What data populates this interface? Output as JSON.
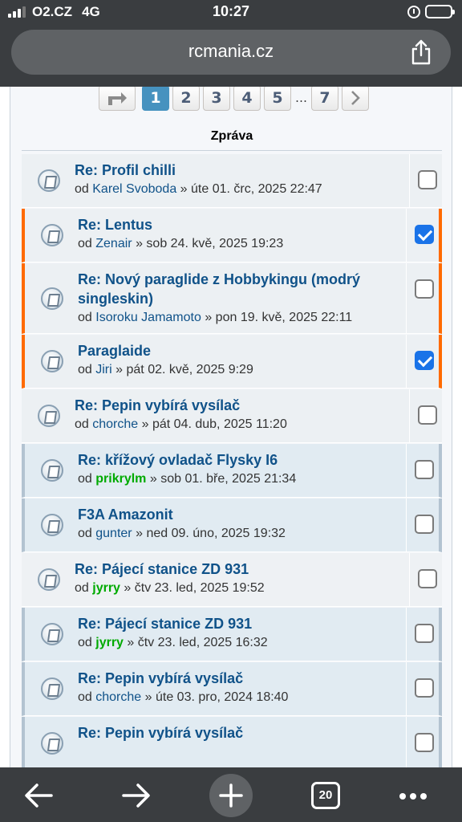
{
  "status": {
    "carrier": "O2.CZ",
    "network": "4G",
    "time": "10:27",
    "battery_level": 1.0
  },
  "browser": {
    "url": "rcmania.cz",
    "tabs_count": "20",
    "icons": [
      "back-arrow-icon",
      "forward-arrow-icon",
      "new-tab-icon",
      "tabs-icon",
      "more-icon",
      "share-icon"
    ]
  },
  "pagination": {
    "pages": [
      "1",
      "2",
      "3",
      "4",
      "5"
    ],
    "ellipsis": "…",
    "last": "7",
    "active": "1"
  },
  "column_header": "Zpráva",
  "posts": [
    {
      "title": "Re: Profil chilli",
      "by": "od",
      "author": "Karel Svoboda",
      "author_color": "blue",
      "sep": "»",
      "date": "úte 01. črc, 2025 22:47",
      "checked": false,
      "style": "bg1"
    },
    {
      "title": "Re: Lentus",
      "by": "od",
      "author": "Zenair",
      "author_color": "blue",
      "sep": "»",
      "date": "sob 24. kvě, 2025 19:23",
      "checked": true,
      "style": "bg1 marked"
    },
    {
      "title": "Re: Nový paraglide z Hobbykingu (modrý singleskin)",
      "by": "od",
      "author": "Isoroku Jamamoto",
      "author_color": "blue",
      "sep": "»",
      "date": "pon 19. kvě, 2025 22:11",
      "checked": false,
      "style": "bg1 marked"
    },
    {
      "title": "Paraglaide",
      "by": "od",
      "author": "Jiri",
      "author_color": "blue",
      "sep": "»",
      "date": "pát 02. kvě, 2025 9:29",
      "checked": true,
      "style": "bg1 marked"
    },
    {
      "title": "Re: Pepin vybírá vysílač",
      "by": "od",
      "author": "chorche",
      "author_color": "blue",
      "sep": "»",
      "date": "pát 04. dub, 2025 11:20",
      "checked": false,
      "style": "bg1"
    },
    {
      "title": "Re: křížový ovladač Flysky I6",
      "by": "od",
      "author": "prikrylm",
      "author_color": "green",
      "sep": "»",
      "date": "sob 01. bře, 2025 21:34",
      "checked": false,
      "style": "bg2 pm"
    },
    {
      "title": "F3A Amazonit",
      "by": "od",
      "author": "gunter",
      "author_color": "blue",
      "sep": "»",
      "date": "ned 09. úno, 2025 19:32",
      "checked": false,
      "style": "bg2 pm"
    },
    {
      "title": "Re: Pájecí stanice ZD 931",
      "by": "od",
      "author": "jyrry",
      "author_color": "green",
      "sep": "»",
      "date": "čtv 23. led, 2025 19:52",
      "checked": false,
      "style": "bg3"
    },
    {
      "title": "Re: Pájecí stanice ZD 931",
      "by": "od",
      "author": "jyrry",
      "author_color": "green",
      "sep": "»",
      "date": "čtv 23. led, 2025 16:32",
      "checked": false,
      "style": "bg2 pm"
    },
    {
      "title": "Re: Pepin vybírá vysílač",
      "by": "od",
      "author": "chorche",
      "author_color": "blue",
      "sep": "»",
      "date": "úte 03. pro, 2024 18:40",
      "checked": false,
      "style": "bg2 pm"
    },
    {
      "title": "Re: Pepin vybírá vysílač",
      "by": "",
      "author": "",
      "author_color": "blue",
      "sep": "",
      "date": "",
      "checked": false,
      "style": "bg2 pm"
    }
  ],
  "colors": {
    "accent": "#4692bf",
    "link": "#105289",
    "marked": "#ff6a00",
    "green_user": "#00aa00"
  }
}
